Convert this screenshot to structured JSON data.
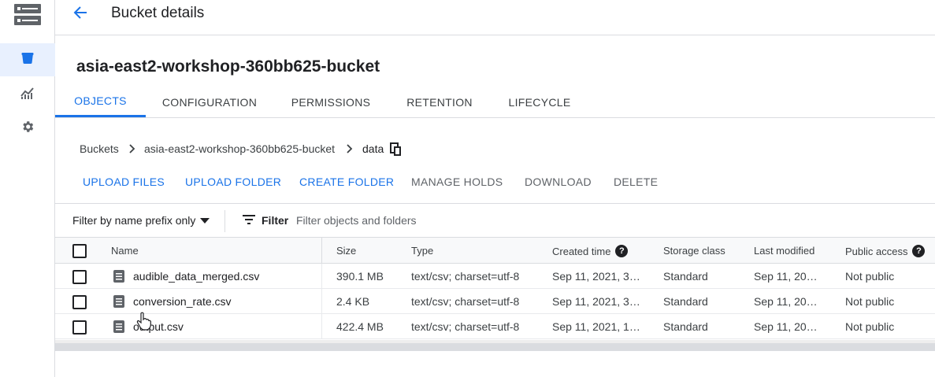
{
  "header": {
    "title": "Bucket details"
  },
  "bucket": {
    "name": "asia-east2-workshop-360bb625-bucket"
  },
  "tabs": [
    {
      "label": "OBJECTS",
      "active": true
    },
    {
      "label": "CONFIGURATION"
    },
    {
      "label": "PERMISSIONS"
    },
    {
      "label": "RETENTION"
    },
    {
      "label": "LIFECYCLE"
    }
  ],
  "breadcrumb": {
    "items": [
      "Buckets",
      "asia-east2-workshop-360bb625-bucket",
      "data"
    ]
  },
  "actions": {
    "upload_files": "UPLOAD FILES",
    "upload_folder": "UPLOAD FOLDER",
    "create_folder": "CREATE FOLDER",
    "manage_holds": "MANAGE HOLDS",
    "download": "DOWNLOAD",
    "delete": "DELETE"
  },
  "filter": {
    "prefix_label": "Filter by name prefix only",
    "filter_label": "Filter",
    "placeholder": "Filter objects and folders"
  },
  "table": {
    "columns": {
      "name": "Name",
      "size": "Size",
      "type": "Type",
      "created": "Created time",
      "storage": "Storage class",
      "modified": "Last modified",
      "public": "Public access"
    },
    "rows": [
      {
        "name": "audible_data_merged.csv",
        "size": "390.1 MB",
        "type": "text/csv; charset=utf-8",
        "created": "Sep 11, 2021, 3…",
        "storage": "Standard",
        "modified": "Sep 11, 20…",
        "public": "Not public"
      },
      {
        "name": "conversion_rate.csv",
        "size": "2.4 KB",
        "type": "text/csv; charset=utf-8",
        "created": "Sep 11, 2021, 3…",
        "storage": "Standard",
        "modified": "Sep 11, 20…",
        "public": "Not public"
      },
      {
        "name": "output.csv",
        "size": "422.4 MB",
        "type": "text/csv; charset=utf-8",
        "created": "Sep 11, 2021, 1…",
        "storage": "Standard",
        "modified": "Sep 11, 20…",
        "public": "Not public"
      }
    ]
  },
  "colors": {
    "accent": "#1a73e8",
    "rail_active": "#e8f0fe",
    "border": "#dadce0"
  },
  "icons": [
    "storage-logo-icon",
    "bucket-icon",
    "monitoring-icon",
    "settings-gear-icon",
    "arrow-back-icon",
    "chevron-right-icon",
    "copy-icon",
    "dropdown-arrow-icon",
    "filter-lines-icon",
    "help-icon",
    "file-icon",
    "hand-cursor-icon"
  ]
}
